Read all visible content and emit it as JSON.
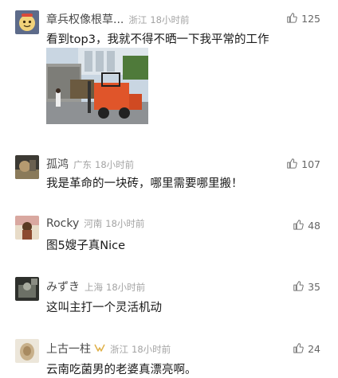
{
  "comments": [
    {
      "username": "章兵权像根草...",
      "location": "浙江",
      "time": "18小时前",
      "likes": "125",
      "text": "看到top3，我就不得不晒一下我平常的工作",
      "avatar_color": "#e9c24a"
    },
    {
      "username": "孤鸿",
      "location": "广东",
      "time": "18小时前",
      "likes": "107",
      "text": "我是革命的一块砖，哪里需要哪里搬！",
      "avatar_color": "#7a6a55"
    },
    {
      "username": "Rocky",
      "location": "河南",
      "time": "18小时前",
      "likes": "48",
      "text": "图5嫂子真Nice",
      "avatar_color": "#b07a4a"
    },
    {
      "username": "みずき",
      "location": "上海",
      "time": "18小时前",
      "likes": "35",
      "text": "这叫主打一个灵活机动",
      "avatar_color": "#555a52"
    },
    {
      "username": "上古一柱",
      "location": "浙江",
      "time": "18小时前",
      "likes": "24",
      "text": "云南吃菌男的老婆真漂亮啊。",
      "avatar_color": "#c8b08a"
    }
  ]
}
